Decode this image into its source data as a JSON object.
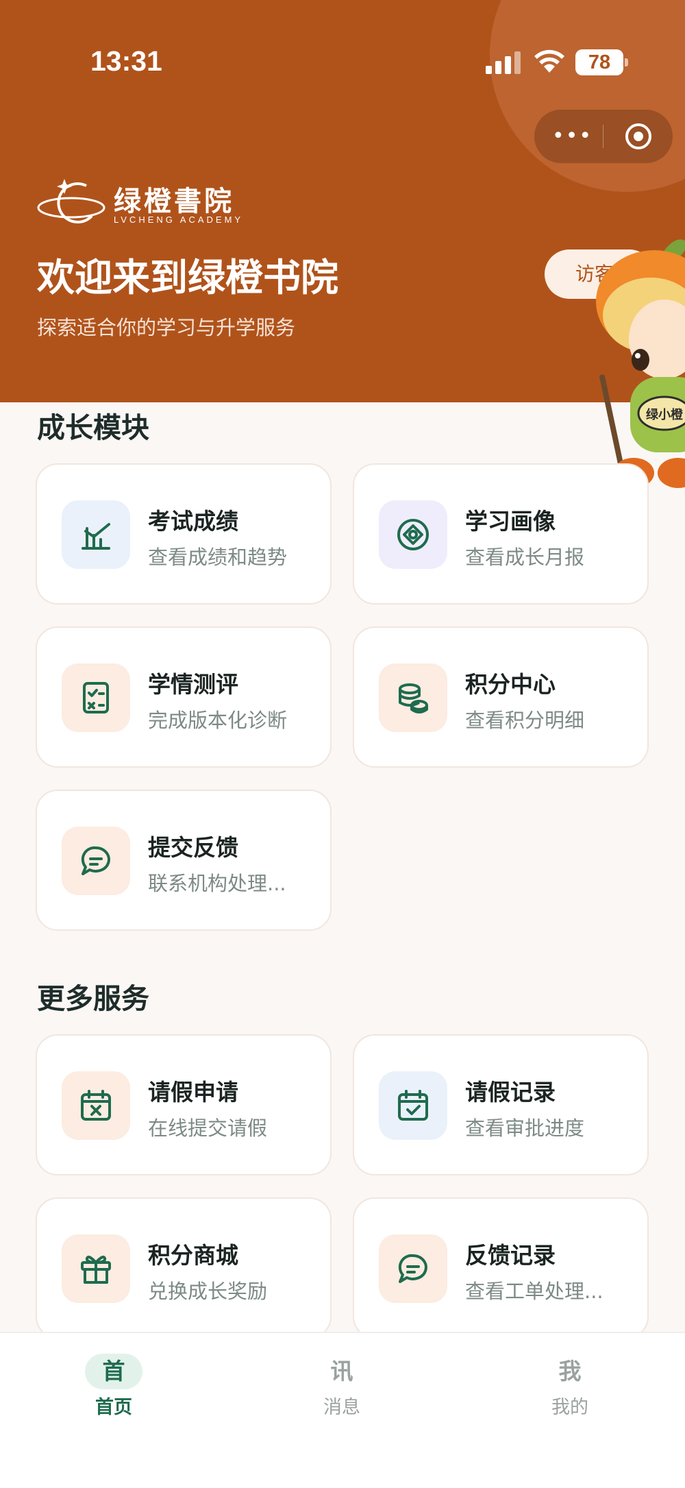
{
  "status_bar": {
    "time": "13:31",
    "battery": "78"
  },
  "header": {
    "brand_name": "绿橙書院",
    "brand_sub": "LVCHENG ACADEMY",
    "welcome": "欢迎来到绿橙书院",
    "subtitle": "探索适合你的学习与升学服务",
    "visitor_label": "访客",
    "mascot_badge": "绿小橙"
  },
  "growth": {
    "title": "成长模块",
    "items": [
      {
        "title": "考试成绩",
        "desc": "查看成绩和趋势",
        "icon": "chart-icon"
      },
      {
        "title": "学习画像",
        "desc": "查看成长月报",
        "icon": "portrait-icon"
      },
      {
        "title": "学情测评",
        "desc": "完成版本化诊断",
        "icon": "checklist-icon"
      },
      {
        "title": "积分中心",
        "desc": "查看积分明细",
        "icon": "coins-icon"
      },
      {
        "title": "提交反馈",
        "desc": "联系机构处理...",
        "icon": "chat-icon"
      }
    ]
  },
  "more": {
    "title": "更多服务",
    "items": [
      {
        "title": "请假申请",
        "desc": "在线提交请假",
        "icon": "calendar-x-icon"
      },
      {
        "title": "请假记录",
        "desc": "查看审批进度",
        "icon": "calendar-check-icon"
      },
      {
        "title": "积分商城",
        "desc": "兑换成长奖励",
        "icon": "gift-icon"
      },
      {
        "title": "反馈记录",
        "desc": "查看工单处理...",
        "icon": "chat-icon"
      }
    ]
  },
  "tabbar": [
    {
      "glyph": "首",
      "label": "首页",
      "active": true
    },
    {
      "glyph": "讯",
      "label": "消息",
      "active": false
    },
    {
      "glyph": "我",
      "label": "我的",
      "active": false
    }
  ],
  "colors": {
    "brand": "#b0531b",
    "accent": "#1f6b4e"
  }
}
